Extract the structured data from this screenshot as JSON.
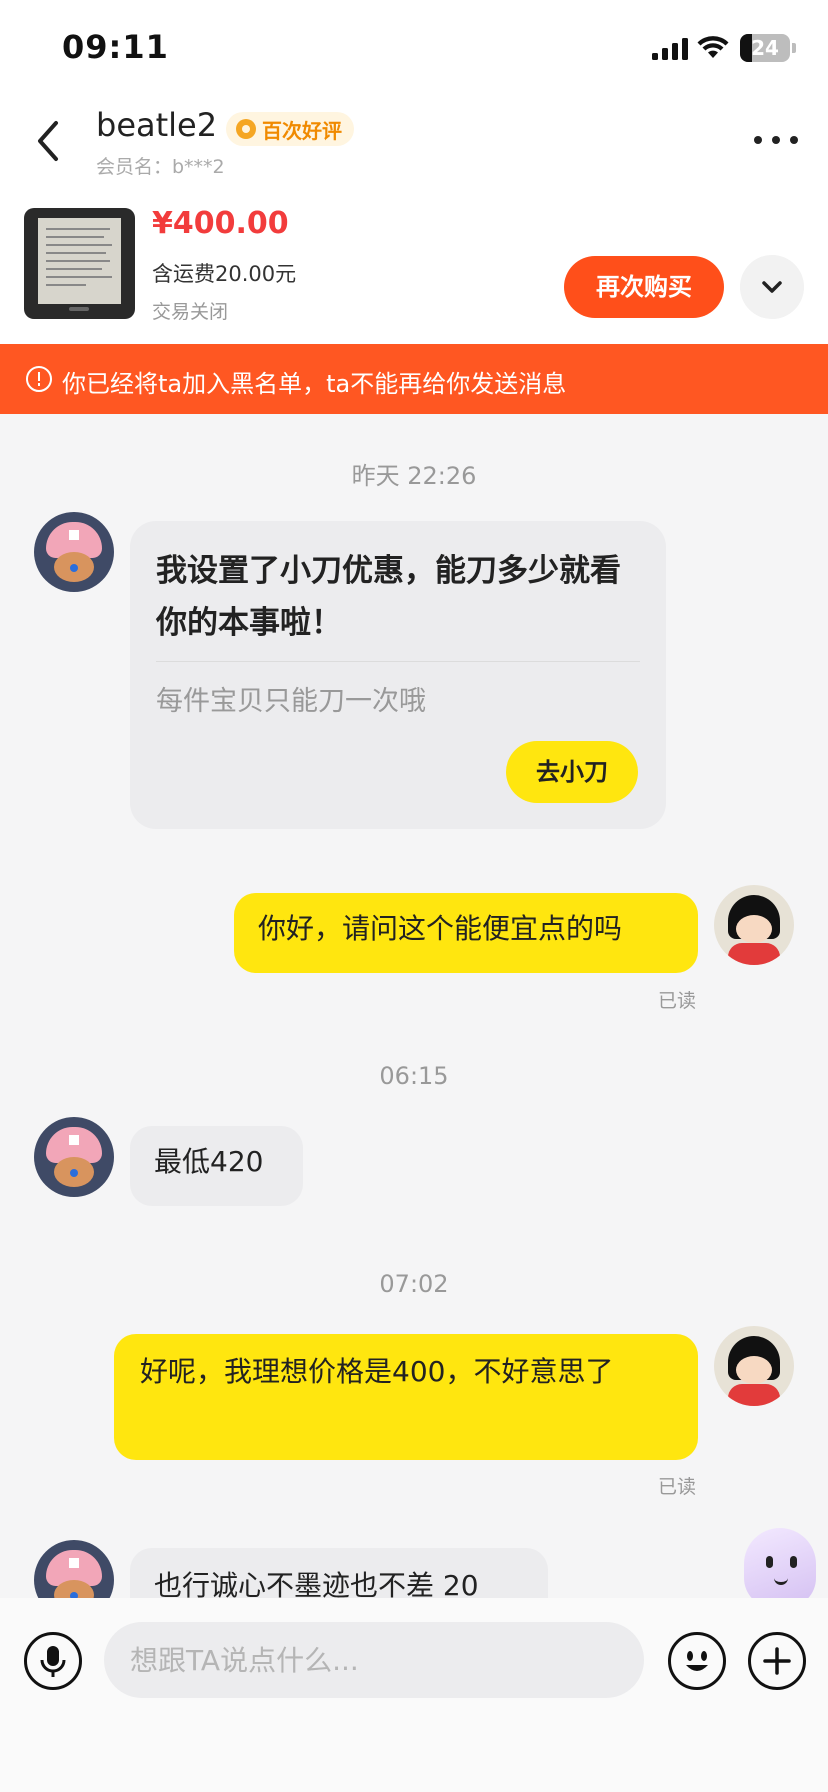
{
  "status_bar": {
    "time": "09:11",
    "battery": "24",
    "battery_level": 0.24
  },
  "header": {
    "seller_name": "beatle2",
    "badge": "百次好评",
    "member_label": "会员名：b***2"
  },
  "product": {
    "price": "¥400.00",
    "shipping": "含运费20.00元",
    "status": "交易关闭",
    "rebuy_label": "再次购买"
  },
  "banner": {
    "text": "你已经将ta加入黑名单，ta不能再给你发送消息"
  },
  "chat": {
    "ts1": "昨天 22:26",
    "coupon": {
      "title": "我设置了小刀优惠，能刀多少就看你的本事啦！",
      "subtitle": "每件宝贝只能刀一次哦",
      "button": "去小刀"
    },
    "msg_out_1": "你好，请问这个能便宜点的吗",
    "read_1": "已读",
    "ts2": "06:15",
    "msg_in_1": "最低420",
    "ts3": "07:02",
    "msg_out_2": "好呢，我理想价格是400，不好意思了",
    "read_2": "已读",
    "msg_in_2": "也行诚心不墨迹也不差 20"
  },
  "input": {
    "placeholder": "想跟TA说点什么..."
  },
  "icons": {
    "back": "chevron-left-icon",
    "more": "more-horizontal-icon",
    "expand": "chevron-down-icon",
    "warning": "alert-circle-icon",
    "mic": "microphone-icon",
    "emoji": "smiley-icon",
    "plus": "plus-circle-icon"
  },
  "colors": {
    "accent": "#ff4f1a",
    "banner": "#ff5722",
    "outgoing": "#ffe60f",
    "price": "#f23c3c"
  }
}
